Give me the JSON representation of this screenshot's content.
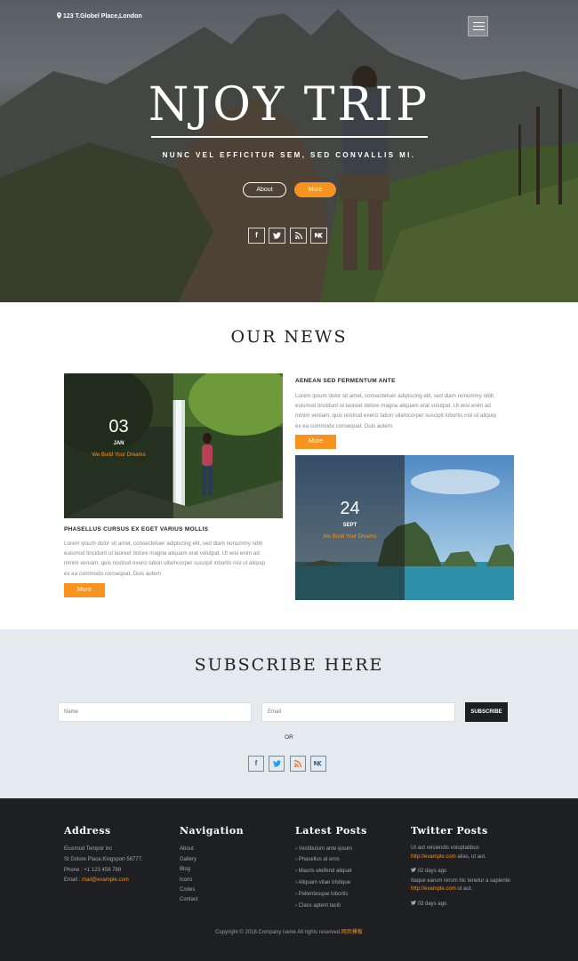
{
  "hero": {
    "address": "123 T.Globel Place,London",
    "title": "NJOY TRIP",
    "subtitle": "NUNC VEL EFFICITUR SEM, SED CONVALLIS MI.",
    "about_label": "About",
    "more_label": "More",
    "social": [
      "f",
      "t",
      "rss",
      "vk"
    ]
  },
  "news": {
    "title": "OUR NEWS",
    "left": {
      "day": "03",
      "month": "JAN",
      "tag": "We Build Your Dreams",
      "heading": "PHASELLUS CURSUS EX EGET VARIUS MOLLIS",
      "text": [
        "Lorem ipsum dolor sit amet, consectetuer adipiscing elit, sed diam nonummy nibh",
        "euismod tincidunt ut laoreet dolore magna aliquam erat volutpat. Ut wisi enim ad",
        "minim veniam, quis nostrud exerci tation ullamcorper suscipit lobortis nisl ut aliquip",
        "ex ea commodo consequat. Duis autem"
      ],
      "more_label": "More"
    },
    "right": {
      "heading": "AENEAN SED FERMENTUM ANTE",
      "text": [
        "Lorem ipsum dolor sit amet, consectetuer adipiscing elit, sed diam nonummy nibh",
        "euismod tincidunt ut laoreet dolore magna aliquam erat volutpat. Ut wisi enim ad",
        "minim veniam, quis nostrud exerci tation ullamcorper suscipit lobortis nisl ut aliquip",
        "ex ea commodo consequat. Duis autem"
      ],
      "more_label": "More",
      "day": "24",
      "month": "SEPT",
      "tag": "We Build Your Dreams"
    }
  },
  "subscribe": {
    "title": "SUBSCRIBE HERE",
    "name_placeholder": "Name",
    "email_placeholder": "Email",
    "button_label": "SUBSCRIBE",
    "or_label": "OR",
    "social": [
      "f",
      "t",
      "rss",
      "vk"
    ]
  },
  "footer": {
    "address": {
      "title": "Address",
      "lines": [
        "Eiusmod Tempor inc",
        "St Dolore Place,Kingsport 56777.",
        "Phone : +1 123 456 789"
      ],
      "email_label": "Email : ",
      "email": "mail@example.com"
    },
    "navigation": {
      "title": "Navigation",
      "items": [
        "About",
        "Gallery",
        "Blog",
        "Icons",
        "Codes",
        "Contact"
      ]
    },
    "latest_posts": {
      "title": "Latest Posts",
      "items": [
        "Vestibulum ante ipsum",
        "Phasellus at eros",
        "Mauris eleifend aliquet",
        "Aliquam vitae tristique",
        "Pellentesque lobortis",
        "Class aptent taciti"
      ]
    },
    "twitter": {
      "title": "Twitter Posts",
      "t1_pre": "Ut aut reiciendis voluptatibus",
      "t1_link": "http://example.com",
      "t1_post": " alias, ut aut.",
      "t1_time": "02 days ago",
      "t2_pre": "Itaque earum rerum hic tenetur a sapiente ",
      "t2_link": "http://example.com",
      "t2_post": " ut aut.",
      "t2_time": "03 days ago"
    },
    "copyright": "Copyright © 2018.Company name All rights reserved.",
    "copyright_link": "网页模板"
  },
  "colors": {
    "accent": "#f7931e",
    "footer_bg": "#1d1f22",
    "subscribe_bg": "#e4eaed"
  }
}
